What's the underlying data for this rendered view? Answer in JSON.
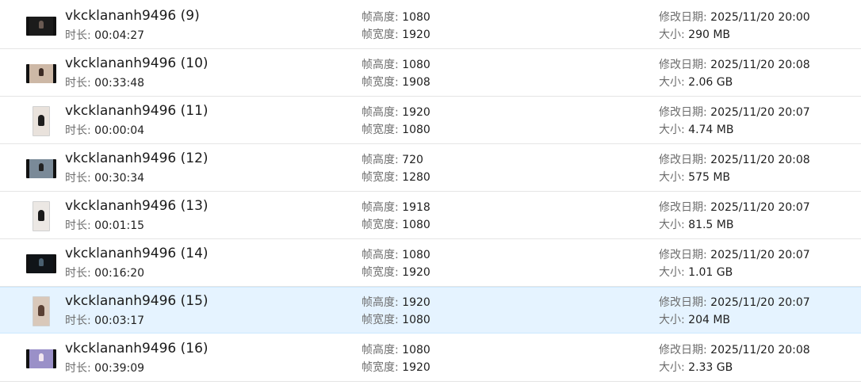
{
  "labels": {
    "duration": "时长: ",
    "frame_height": "帧高度: ",
    "frame_width": "帧宽度: ",
    "modified": "修改日期: ",
    "size": "大小: "
  },
  "selected_index": 6,
  "files": [
    {
      "name": "vkcklananh9496 (9)",
      "duration": "00:04:27",
      "frame_height": "1080",
      "frame_width": "1920",
      "modified": "2025/11/20 20:00",
      "size": "290 MB",
      "thumb": {
        "orientation": "landscape",
        "bg": "#1b1b1b",
        "accent": "#6a5a52"
      }
    },
    {
      "name": "vkcklananh9496 (10)",
      "duration": "00:33:48",
      "frame_height": "1080",
      "frame_width": "1908",
      "modified": "2025/11/20 20:08",
      "size": "2.06 GB",
      "thumb": {
        "orientation": "landscape",
        "bg": "#cdb8a6",
        "accent": "#3b2a24"
      }
    },
    {
      "name": "vkcklananh9496 (11)",
      "duration": "00:00:04",
      "frame_height": "1920",
      "frame_width": "1080",
      "modified": "2025/11/20 20:07",
      "size": "4.74 MB",
      "thumb": {
        "orientation": "portrait",
        "bg": "#e9e2dc",
        "accent": "#1e1e1e"
      }
    },
    {
      "name": "vkcklananh9496 (12)",
      "duration": "00:30:34",
      "frame_height": "720",
      "frame_width": "1280",
      "modified": "2025/11/20 20:08",
      "size": "575 MB",
      "thumb": {
        "orientation": "landscape",
        "bg": "#7a8a98",
        "accent": "#222222"
      }
    },
    {
      "name": "vkcklananh9496 (13)",
      "duration": "00:01:15",
      "frame_height": "1918",
      "frame_width": "1080",
      "modified": "2025/11/20 20:07",
      "size": "81.5 MB",
      "thumb": {
        "orientation": "portrait",
        "bg": "#ece8e4",
        "accent": "#1a1a1a"
      }
    },
    {
      "name": "vkcklananh9496 (14)",
      "duration": "00:16:20",
      "frame_height": "1080",
      "frame_width": "1920",
      "modified": "2025/11/20 20:07",
      "size": "1.01 GB",
      "thumb": {
        "orientation": "landscape",
        "bg": "#101418",
        "accent": "#4a6070"
      }
    },
    {
      "name": "vkcklananh9496 (15)",
      "duration": "00:03:17",
      "frame_height": "1920",
      "frame_width": "1080",
      "modified": "2025/11/20 20:07",
      "size": "204 MB",
      "thumb": {
        "orientation": "portrait",
        "bg": "#d9c8ba",
        "accent": "#5a4034"
      }
    },
    {
      "name": "vkcklananh9496 (16)",
      "duration": "00:39:09",
      "frame_height": "1080",
      "frame_width": "1920",
      "modified": "2025/11/20 20:08",
      "size": "2.33 GB",
      "thumb": {
        "orientation": "landscape",
        "bg": "#9a90c8",
        "accent": "#f2e6f0"
      }
    }
  ]
}
